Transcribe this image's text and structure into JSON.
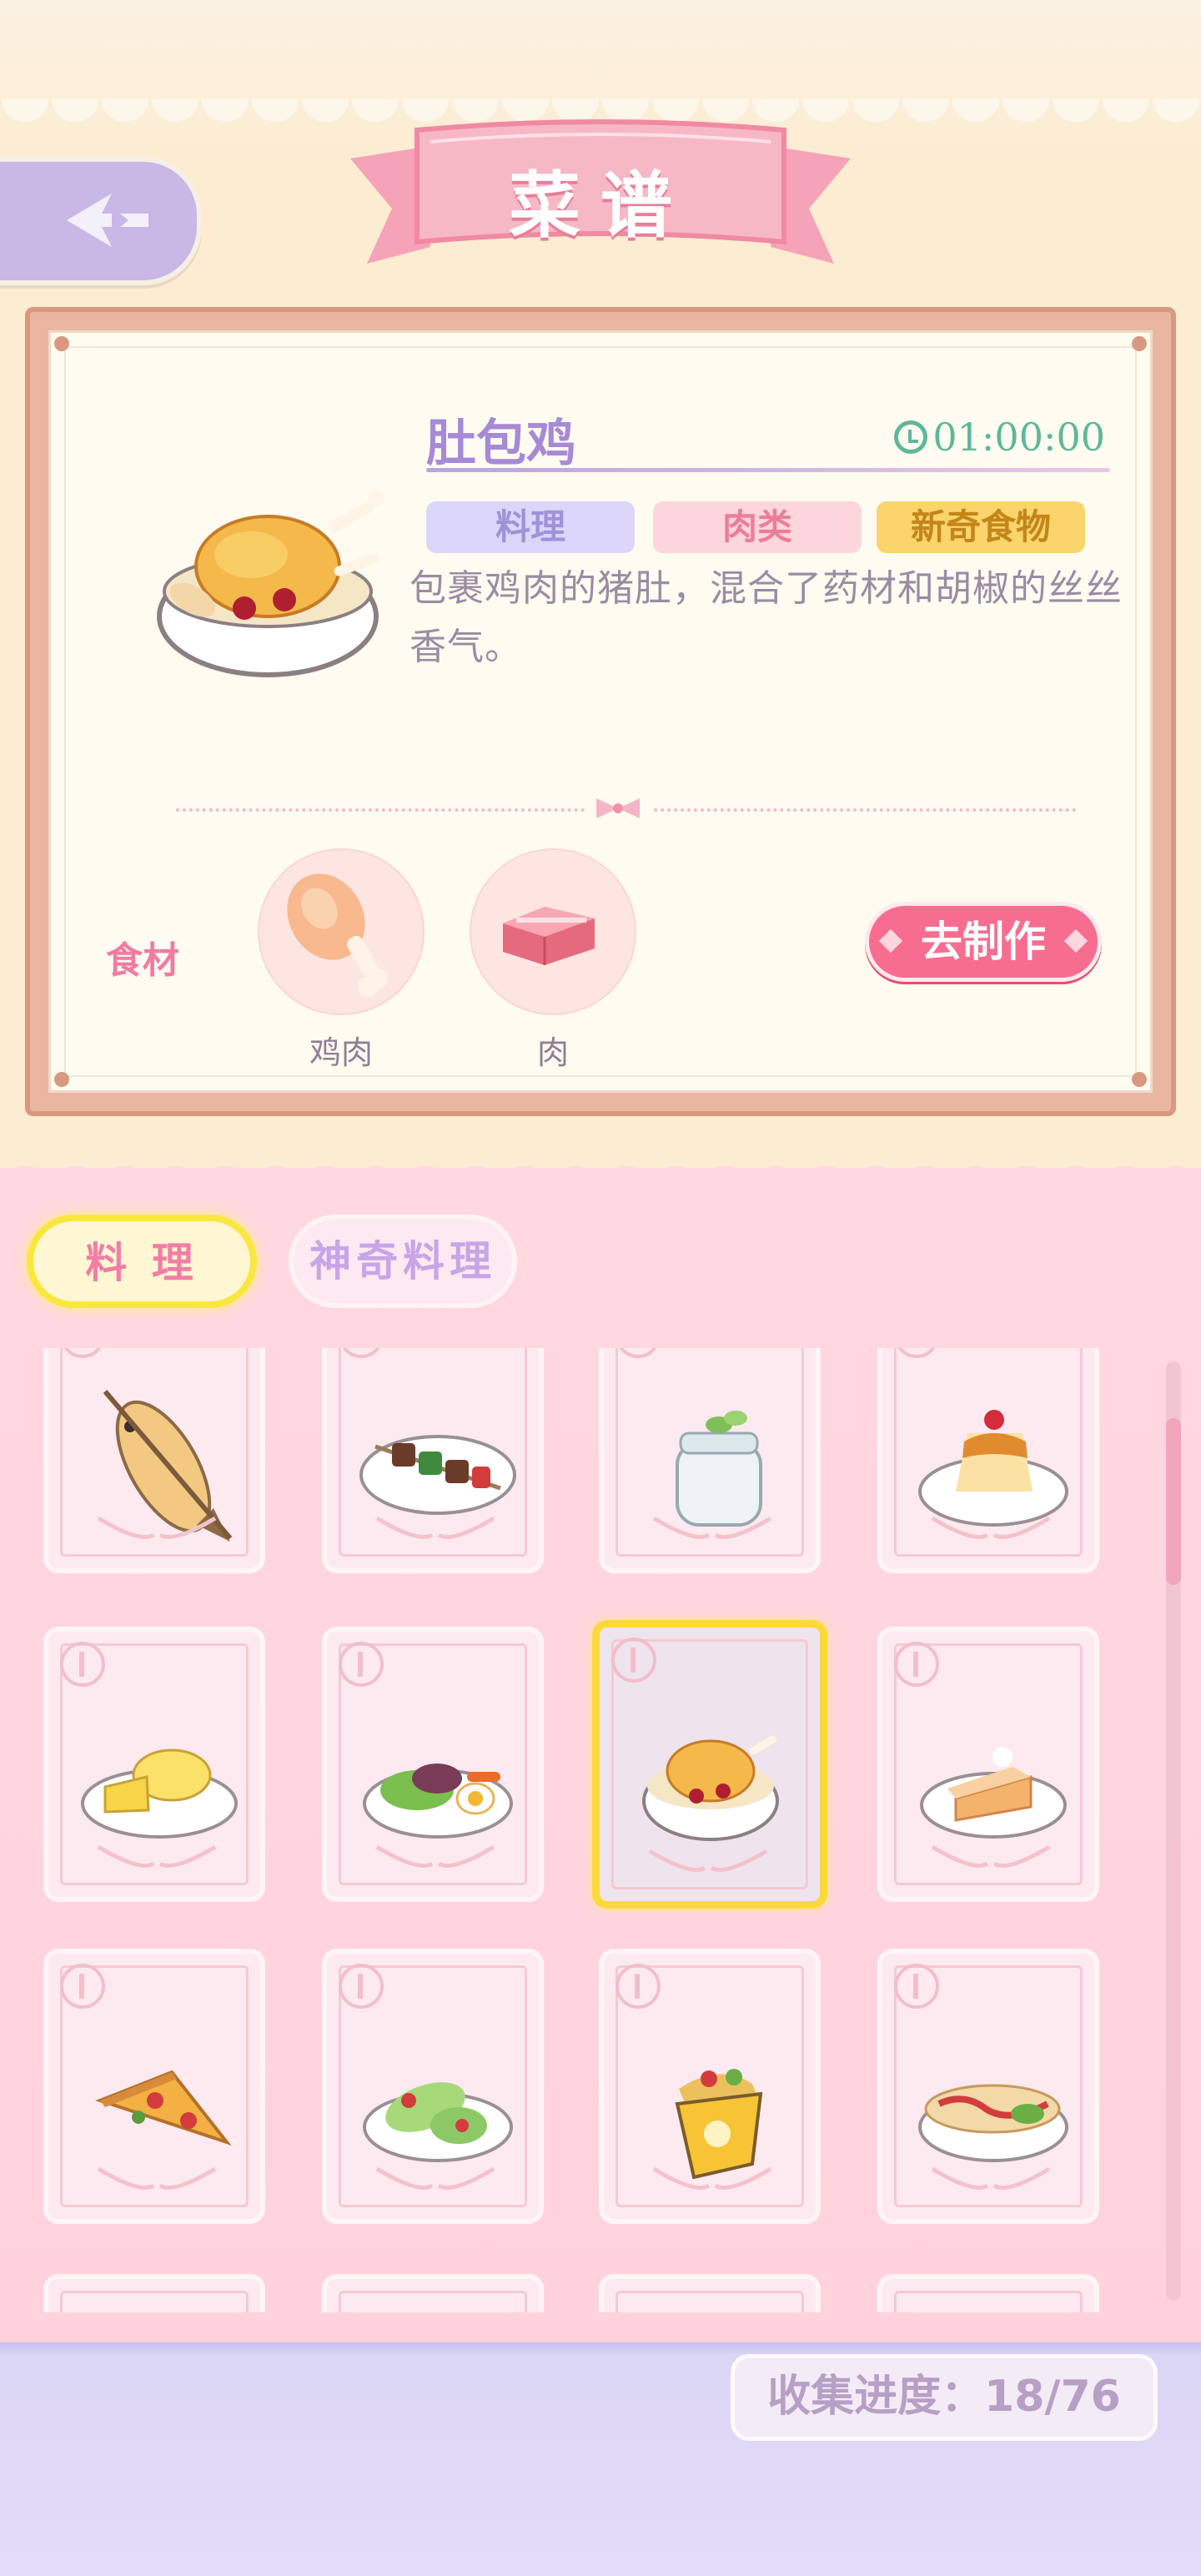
{
  "header": {
    "title": "菜谱",
    "back_icon": "back-arrow-icon"
  },
  "detail": {
    "dish_name": "肚包鸡",
    "timer": "01:00:00",
    "tags": [
      "料理",
      "肉类",
      "新奇食物"
    ],
    "description": "包裹鸡肉的猪肚，混合了药材和胡椒的丝丝香气。",
    "ingredients_label": "食材",
    "ingredients": [
      {
        "name": "鸡肉",
        "icon": "chicken-drumstick-icon"
      },
      {
        "name": "肉",
        "icon": "meat-slab-icon"
      }
    ],
    "make_button": "去制作"
  },
  "tabs": {
    "cooking": "料 理",
    "magic_cooking": "神奇料理",
    "active": "cooking"
  },
  "recipes": [
    {
      "icon": "grilled-fish-icon"
    },
    {
      "icon": "kebab-plate-icon"
    },
    {
      "icon": "yogurt-jar-icon"
    },
    {
      "icon": "pudding-plate-icon"
    },
    {
      "icon": "cheese-plate-icon"
    },
    {
      "icon": "salad-plate-icon"
    },
    {
      "icon": "pork-tripe-chicken-bowl-icon",
      "selected": true
    },
    {
      "icon": "cake-slice-plate-icon"
    },
    {
      "icon": "pizza-slice-icon"
    },
    {
      "icon": "lettuce-wrap-icon"
    },
    {
      "icon": "wrap-bag-icon"
    },
    {
      "icon": "hotdog-plate-icon"
    }
  ],
  "progress": {
    "text": "收集进度：18/76",
    "collected": 18,
    "total": 76
  },
  "colors": {
    "accent_pink": "#f76d8f",
    "title_purple": "#a78ad7",
    "timer_green": "#5fb79a",
    "tab_active_border": "#f9e73f"
  }
}
